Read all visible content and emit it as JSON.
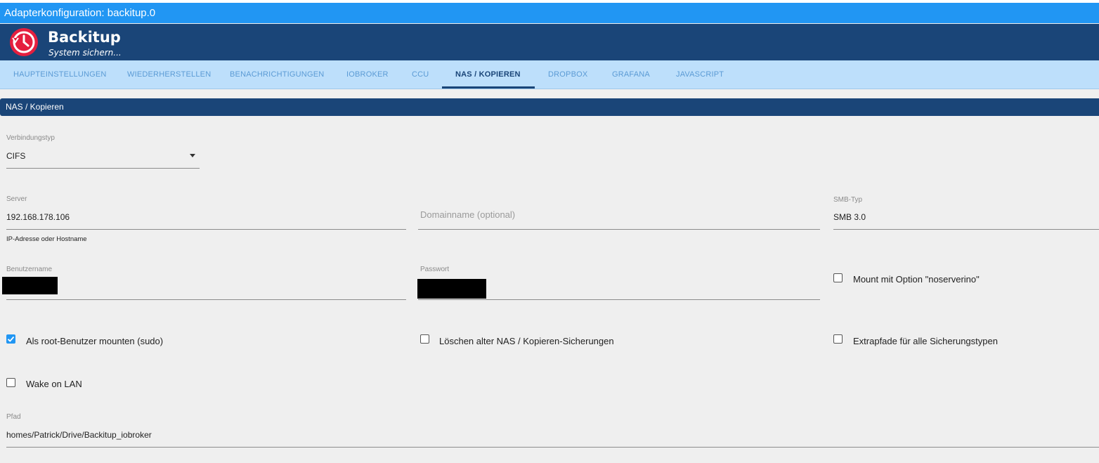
{
  "window": {
    "title": "Adapterkonfiguration: backitup.0"
  },
  "header": {
    "title": "Backitup",
    "subtitle": "System sichern...",
    "logo_icon": "clock-restore-icon",
    "logo_color": "#e51f3f"
  },
  "tabs": [
    {
      "label": "HAUPTEINSTELLUNGEN",
      "active": false
    },
    {
      "label": "WIEDERHERSTELLEN",
      "active": false
    },
    {
      "label": "BENACHRICHTIGUNGEN",
      "active": false
    },
    {
      "label": "IOBROKER",
      "active": false
    },
    {
      "label": "CCU",
      "active": false
    },
    {
      "label": "NAS / KOPIEREN",
      "active": true
    },
    {
      "label": "DROPBOX",
      "active": false
    },
    {
      "label": "GRAFANA",
      "active": false
    },
    {
      "label": "JAVASCRIPT",
      "active": false
    }
  ],
  "section": {
    "title": "NAS / Kopieren"
  },
  "form": {
    "connection_type": {
      "label": "Verbindungstyp",
      "value": "CIFS"
    },
    "server": {
      "label": "Server",
      "value": "192.168.178.106",
      "helper": "IP-Adresse oder Hostname"
    },
    "domain": {
      "placeholder": "Domainname (optional)"
    },
    "smb_type": {
      "label": "SMB-Typ",
      "value": "SMB 3.0"
    },
    "username": {
      "label": "Benutzername"
    },
    "password": {
      "label": "Passwort"
    },
    "noserverino": {
      "label": "Mount mit Option \"noserverino\"",
      "checked": false
    },
    "sudo": {
      "label": "Als root-Benutzer mounten (sudo)",
      "checked": true
    },
    "delete_old": {
      "label": "Löschen alter NAS / Kopieren-Sicherungen",
      "checked": false
    },
    "extrapaths": {
      "label": "Extrapfade für alle Sicherungstypen",
      "checked": false
    },
    "wol": {
      "label": "Wake on LAN",
      "checked": false
    },
    "path": {
      "label": "Pfad",
      "value": "homes/Patrick/Drive/Backitup_iobroker"
    }
  },
  "colors": {
    "titlebar": "#2196f3",
    "header": "#1a4578",
    "tabbar": "#bddffb",
    "accent": "#2196f3"
  }
}
